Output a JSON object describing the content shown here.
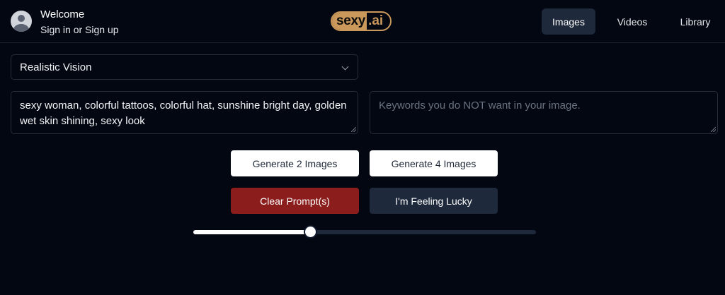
{
  "header": {
    "welcome": "Welcome",
    "signin": "Sign in or Sign up",
    "logo_left": "sexy",
    "logo_right": ".ai",
    "nav": [
      {
        "label": "Images",
        "active": true
      },
      {
        "label": "Videos",
        "active": false
      },
      {
        "label": "Library",
        "active": false
      }
    ]
  },
  "model_select": {
    "value": "Realistic Vision"
  },
  "prompt": {
    "value": "sexy woman, colorful tattoos, colorful hat, sunshine bright day, golden wet skin shining, sexy look"
  },
  "negative_prompt": {
    "placeholder": "Keywords you do NOT want in your image."
  },
  "buttons": {
    "generate_2": "Generate 2 Images",
    "generate_4": "Generate 4 Images",
    "clear": "Clear Prompt(s)",
    "lucky": "I'm Feeling Lucky"
  },
  "slider": {
    "value_fraction": 0.34
  },
  "colors": {
    "background": "#030712",
    "brand_gold": "#c9985a",
    "clear_button": "#8b1d1d",
    "dark_button": "#1e293b"
  }
}
